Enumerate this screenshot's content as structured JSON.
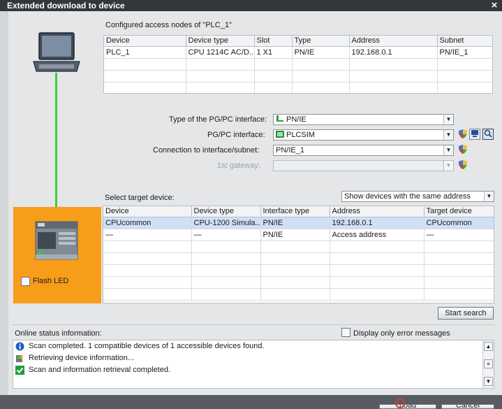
{
  "window": {
    "title": "Extended download to device",
    "close_glyph": "×"
  },
  "accessNodes": {
    "heading": "Configured access nodes of \"PLC_1\"",
    "columns": [
      "Device",
      "Device type",
      "Slot",
      "Type",
      "Address",
      "Subnet"
    ],
    "rows": [
      [
        "PLC_1",
        "CPU 1214C AC/D...",
        "1 X1",
        "PN/IE",
        "192.168.0.1",
        "PN/IE_1"
      ]
    ]
  },
  "interface": {
    "type_label": "Type of the PG/PC interface:",
    "type_value": "PN/IE",
    "pgpc_label": "PG/PC interface:",
    "pgpc_value": "PLCSIM",
    "connection_label": "Connection to interface/subnet:",
    "connection_value": "PN/IE_1",
    "gateway_label": "1st gateway:",
    "gateway_value": ""
  },
  "targets": {
    "label": "Select target device:",
    "filter_value": "Show devices with the same address",
    "columns": [
      "Device",
      "Device type",
      "Interface type",
      "Address",
      "Target device"
    ],
    "rows": [
      [
        "CPUcommon",
        "CPU-1200 Simula...",
        "PN/IE",
        "192.168.0.1",
        "CPUcommon"
      ],
      [
        "—",
        "—",
        "PN/IE",
        "Access address",
        "—"
      ]
    ]
  },
  "flash_led_label": "Flash LED",
  "start_search_label": "Start search",
  "online": {
    "label": "Online status information:",
    "error_only_label": "Display only error messages",
    "messages": [
      {
        "icon": "info-icon",
        "text": "Scan completed. 1 compatible devices of 1 accessible devices found."
      },
      {
        "icon": "device-icon",
        "text": "Retrieving device information..."
      },
      {
        "icon": "check-icon",
        "text": "Scan and information retrieval completed."
      }
    ]
  },
  "footer": {
    "load_label": "Load",
    "cancel_label": "Cancel"
  },
  "colors": {
    "link_line": "#3bd03b",
    "panel_orange": "#f79d1a",
    "selection": "#cfe0f6",
    "titlebar": "#32373c"
  }
}
